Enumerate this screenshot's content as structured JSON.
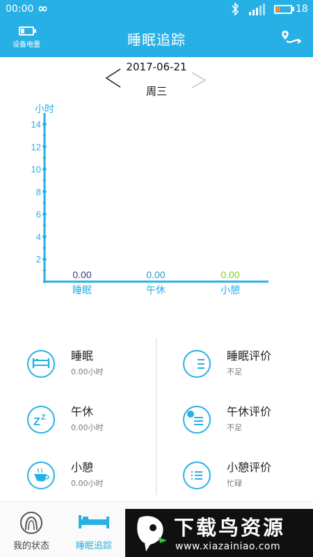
{
  "status_bar": {
    "time": "00:00",
    "loop_glyph": "∞",
    "battery_level": "18",
    "icons": [
      "bluetooth-icon",
      "signal-icon",
      "battery-icon"
    ]
  },
  "header": {
    "title": "睡眠追踪",
    "device_battery_label": "设备电量",
    "route_icon": "route-icon"
  },
  "date_nav": {
    "date": "2017-06-21",
    "weekday": "周三"
  },
  "chart_data": {
    "type": "bar",
    "ylabel": "小时",
    "ylim": [
      0,
      15
    ],
    "yticks": [
      2,
      4,
      6,
      8,
      10,
      12,
      14
    ],
    "categories": [
      "睡眠",
      "午休",
      "小憩"
    ],
    "values": [
      0,
      0,
      0
    ],
    "value_labels": [
      "0.00",
      "0.00",
      "0.00"
    ],
    "value_colors": [
      "#3a3a8c",
      "#27a0c8",
      "#7ed321"
    ],
    "axis_color": "#27b0e6"
  },
  "stats": {
    "left": [
      {
        "name": "睡眠",
        "value": "0.00小时",
        "icon": "bed-icon"
      },
      {
        "name": "午休",
        "value": "0.00小时",
        "icon": "zz-icon"
      },
      {
        "name": "小憩",
        "value": "0.00小时",
        "icon": "coffee-cup-icon"
      }
    ],
    "right": [
      {
        "name": "睡眠评价",
        "value": "不足",
        "icon": "moon-list-icon"
      },
      {
        "name": "午休评价",
        "value": "不足",
        "icon": "sun-list-icon"
      },
      {
        "name": "小憩评价",
        "value": "忙碌",
        "icon": "list-icon"
      }
    ]
  },
  "bottom_nav": {
    "items": [
      {
        "label": "我的状态",
        "icon": "head-icon"
      },
      {
        "label": "睡眠追踪",
        "icon": "bed-icon"
      }
    ]
  },
  "watermark": {
    "text": "下载鸟资源",
    "url": "www.xiazainiao.com"
  },
  "colors": {
    "accent": "#27b0e6"
  }
}
